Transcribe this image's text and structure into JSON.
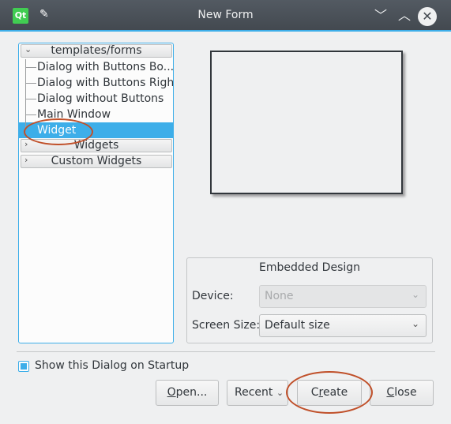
{
  "window": {
    "title": "New Form",
    "app_icon": "qt-creator-icon",
    "controls": [
      "minimize",
      "maximize",
      "close"
    ]
  },
  "tree": {
    "categories": [
      {
        "label": "templates/forms",
        "expanded": true
      },
      {
        "label": "Widgets",
        "expanded": false
      },
      {
        "label": "Custom Widgets",
        "expanded": false
      }
    ],
    "items": [
      {
        "label": "Dialog with Buttons Bo...",
        "selected": false
      },
      {
        "label": "Dialog with Buttons Right",
        "selected": false
      },
      {
        "label": "Dialog without Buttons",
        "selected": false
      },
      {
        "label": "Main Window",
        "selected": false
      },
      {
        "label": "Widget",
        "selected": true
      }
    ]
  },
  "embedded": {
    "title": "Embedded Design",
    "device_label": "Device:",
    "device_value": "None",
    "screen_label": "Screen Size:",
    "screen_value": "Default size"
  },
  "startup_checkbox": {
    "label": "Show this Dialog on Startup",
    "checked": true
  },
  "buttons": {
    "open": {
      "pre": "",
      "mn": "O",
      "post": "pen..."
    },
    "recent": "Recent",
    "create": {
      "pre": "C",
      "mn": "r",
      "post": "eate"
    },
    "close": {
      "pre": "",
      "mn": "C",
      "post": "lose"
    }
  },
  "colors": {
    "accent": "#3daee9",
    "annotation": "#c0502a"
  }
}
